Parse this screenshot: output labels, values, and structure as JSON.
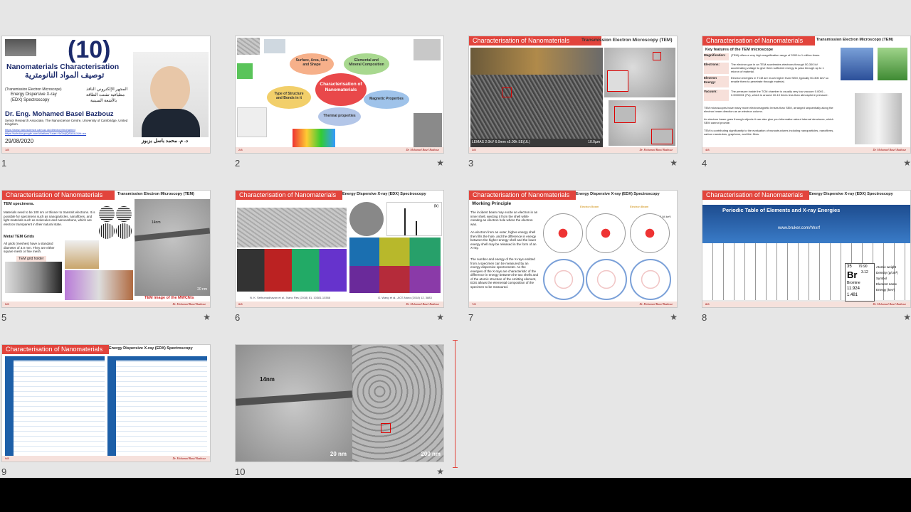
{
  "slides": [
    {
      "number": "1",
      "page": "1/8",
      "title_num": "(10)",
      "title_en": "Nanomaterials Characterisation",
      "title_ar": "توصيف المواد النانومترية",
      "sub_en": "(Transmission Electron Microscope)",
      "sub_en2": "Energy Dispersive X-ray",
      "sub_en3": "(EDX) Spectroscopy",
      "sub_ar": "المجهر الإلكتروني النافذ",
      "sub_ar2": "مطيافية تشتت الطاقة",
      "sub_ar3": "بالأشعة السينية",
      "author": "Dr. Eng. Mohamed Basel Bazbouz",
      "affiliation": "Senior Research Associate, The Nanoscience Centre, University of Cambridge, United Kingdom.",
      "link1": "https://www.nanoscience.cam.ac.uk/directory/mohamed",
      "link2": "https://scholar.google.com/citations?user=4s1lxjiQAAAAJ&hl=en",
      "date": "29/08/2020",
      "author_ar": "د. م. محمد باسل بزبوز"
    },
    {
      "number": "2",
      "page": "2/8",
      "star": "★",
      "center": "Characterisation of Nanomaterials",
      "bubbles": [
        "Surface, Area, Size and Shape",
        "Elemental and Mineral Composition",
        "Type of Structure and Bonds in it",
        "Magnetic Properties",
        "Thermal properties"
      ],
      "footer_author": "Dr. Mohamed Basel Bazbouz"
    },
    {
      "number": "3",
      "page": "3/8",
      "star": "★",
      "header": "Characterisation of Nanomaterials",
      "subheader": "Transmission Electron Microscopy (TEM)",
      "caption": "LEMAS 2.0kV 6.0mm x5.00k SE(UL)",
      "scale": "10.0µm",
      "footer_author": "Dr. Mohamed Basel Bazbouz"
    },
    {
      "number": "4",
      "page": "4/8",
      "star": "★",
      "header": "Characterisation of Nanomaterials",
      "subheader": "Transmission Electron Microscopy (TEM)",
      "key": "Key features of the TEM microscope",
      "rows": [
        {
          "label": "Magnification:",
          "text": "(TEM) offers a very high magnification range of 2000 to 1 million times."
        },
        {
          "label": "Electrons:",
          "text": "The electron gun in an TEM accelerates electrons through 50-300 kV accelerating voltage to give them sufficient energy to pass through up to 1 micron of material."
        },
        {
          "label": "Electron Energy:",
          "text": "Electron energies in TCM are much higher than SEM, typically 50-300 keV so enable them to penetrate through material."
        },
        {
          "label": "Vacuum:",
          "text": "The pressure inside the TCM chamber is usually very low vacuum 0.0001 - 0.0000001 (Pa), which is around 10-10 times less than atmosphere pressure."
        }
      ],
      "para1": "TEM microscopes have many more electromagnetic lenses than SEM, arranged sequentially along the electron beam direction as an electron column.",
      "para2": "An electron beam goes through objects it can also give you information about internal structures, which SEM cannot provide.",
      "para3": "TEM is contributing significantly to the evaluation of nanostructures including nanoparticles, nanofibres, carbon nanotubes, graphene, and thin films.",
      "footer_author": "Dr. Mohamed Basel Bazbouz"
    },
    {
      "number": "5",
      "page": "5/8",
      "star": "★",
      "header": "Characterisation of Nanomaterials",
      "subheader": "Transmission Electron Microscopy (TEM)",
      "specimens": "TEM specimens.",
      "spec_text": "Materials need to be 100 nm or thinner to transmit electrons. It is possible for specimens such as nanoparticles, nanofibres, and light materials such as molecules and nanocarbons, which are electron transparent in their natural state.",
      "grids": "Metal TEM Grids",
      "grids_text": "All grids (meshes) have a standard diameter of 3.0 mm. They are either square mesh or fine mesh.",
      "holder": "TEM grid holder",
      "label14": "14nm",
      "scale": "20 nm",
      "image_caption": "TEM image of the MWCNts",
      "footer_author": "Dr. Mohamed Basel Bazbouz"
    },
    {
      "number": "6",
      "page": "6/8",
      "star": "★",
      "header": "Characterisation of Nanomaterials",
      "subheader": "Energy Dispersive X-ray (EDX) Spectroscopy",
      "label_b": "(b)",
      "ref1": "N. K. Sethumadhavan et al., Nano Res (2018) 81, 10381-10388",
      "ref2": "G. Wang et al., ACS Nano (2018) 12, 3883",
      "footer_author": "Dr. Mohamed Basel Bazbouz"
    },
    {
      "number": "7",
      "page": "7/8",
      "star": "★",
      "header": "Characterisation of Nanomaterials",
      "subheader": "Energy Dispersive X-ray (EDX) Spectroscopy",
      "principle": "Working Principle",
      "p1": "The incident beam may excite an electron in an inner shell, ejecting it from the shell while creating an electron hole where the electron was.",
      "p2": "An electron from an outer, higher-energy shell then fills the hole, and the difference in energy between the higher-energy shell and the lower energy shell may be released in the form of an X-ray.",
      "p3": "The number and energy of the X-rays emitted from a specimen can be measured by an energy-dispersive spectrometer. As the energies of the X-rays are characteristic of the difference in energy between the two shells and of the atomic structure of the emitting element, EDS allows the elemental composition of the specimen to be measured.",
      "label_beam1": "Electron Beam",
      "label_beam2": "Electron Beam",
      "label_kev": "8.04 keV",
      "footer_author": "Dr. Mohamed Basel Bazbouz"
    },
    {
      "number": "8",
      "page": "8/8",
      "star": "★",
      "header": "Characterisation of Nanomaterials",
      "subheader": "Energy Dispersive X-ray (EDX) Spectroscopy",
      "banner": "Periodic Table of Elements and X-ray Energies",
      "url": "www.bruker.com/hhxrf",
      "element": "Br",
      "element_no": "35",
      "element_w": "79.90",
      "element_d": "3.12",
      "element_name": "Bromine",
      "ka": "11.924",
      "lb": "1.481",
      "legend": [
        "Atomic weight",
        "Density (g/cm³)",
        "Symbol",
        "Element name",
        "Energy (keV)"
      ],
      "footer_author": "Dr. Mohamed Basel Bazbouz"
    },
    {
      "number": "9",
      "page": "9/8",
      "header": "Characterisation of Nanomaterials",
      "subheader": "Energy Dispersive X-ray (EDX) Spectroscopy",
      "footer_author": "Dr. Mohamed Basel Bazbouz"
    },
    {
      "number": "10",
      "star": "★",
      "label14": "14nm",
      "scale1": "20 nm",
      "scale2": "200 nm"
    }
  ]
}
